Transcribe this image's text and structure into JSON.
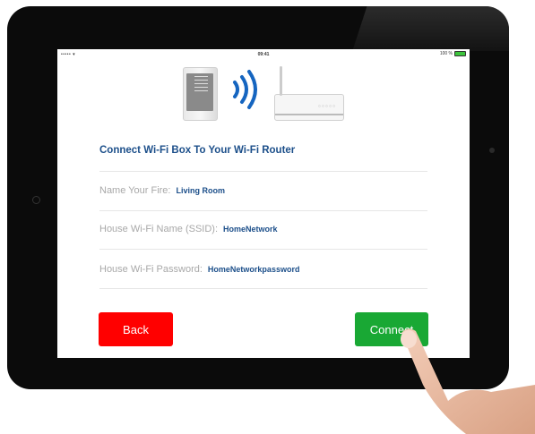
{
  "status_bar": {
    "signal": "••••• ▾",
    "time": "09:41",
    "battery_text": "100 %",
    "battery_level": 1.0
  },
  "title": "Connect Wi-Fi Box To Your Wi-Fi Router",
  "fields": [
    {
      "label": "Name Your Fire:",
      "value": "Living Room"
    },
    {
      "label": "House Wi-Fi Name (SSID):",
      "value": "HomeNetwork"
    },
    {
      "label": "House Wi-Fi Password:",
      "value": "HomeNetworkpassword"
    }
  ],
  "buttons": {
    "back": "Back",
    "connect": "Connect"
  },
  "colors": {
    "title": "#1c4f8a",
    "back": "#ff0000",
    "connect": "#19a834",
    "wifi_waves": "#1565c0"
  },
  "icons": {
    "wifi": "wifi-waves-icon",
    "device": "wifi-box-icon",
    "router": "router-icon"
  }
}
